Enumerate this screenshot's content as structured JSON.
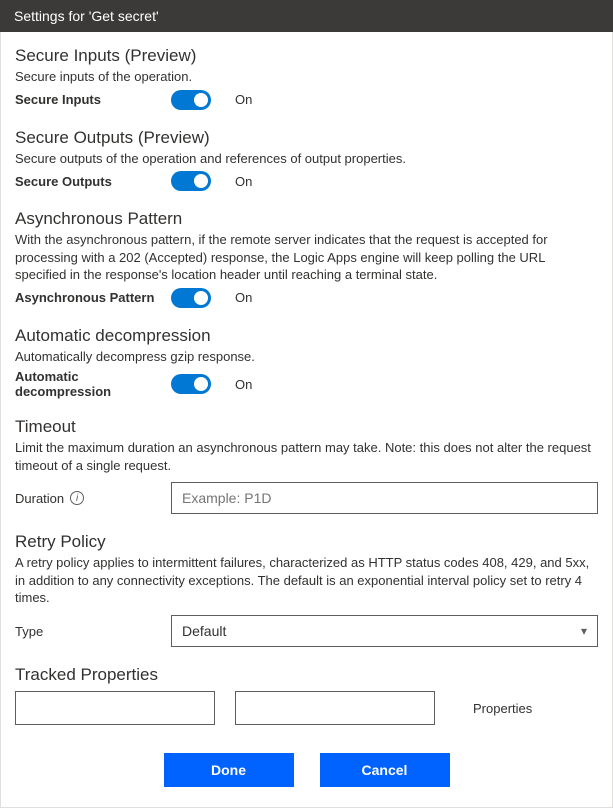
{
  "titlebar": "Settings for 'Get secret'",
  "secureInputs": {
    "heading": "Secure Inputs (Preview)",
    "desc": "Secure inputs of the operation.",
    "label": "Secure Inputs",
    "state": "On"
  },
  "secureOutputs": {
    "heading": "Secure Outputs (Preview)",
    "desc": "Secure outputs of the operation and references of output properties.",
    "label": "Secure Outputs",
    "state": "On"
  },
  "asyncPattern": {
    "heading": "Asynchronous Pattern",
    "desc": "With the asynchronous pattern, if the remote server indicates that the request is accepted for processing with a 202 (Accepted) response, the Logic Apps engine will keep polling the URL specified in the response's location header until reaching a terminal state.",
    "label": "Asynchronous Pattern",
    "state": "On"
  },
  "autoDecomp": {
    "heading": "Automatic decompression",
    "desc": "Automatically decompress gzip response.",
    "label": "Automatic decompression",
    "state": "On"
  },
  "timeout": {
    "heading": "Timeout",
    "desc": "Limit the maximum duration an asynchronous pattern may take. Note: this does not alter the request timeout of a single request.",
    "label": "Duration",
    "placeholder": "Example: P1D",
    "value": ""
  },
  "retry": {
    "heading": "Retry Policy",
    "desc": "A retry policy applies to intermittent failures, characterized as HTTP status codes 408, 429, and 5xx, in addition to any connectivity exceptions. The default is an exponential interval policy set to retry 4 times.",
    "label": "Type",
    "selected": "Default"
  },
  "tracked": {
    "heading": "Tracked Properties",
    "key": "",
    "value": "",
    "label": "Properties"
  },
  "buttons": {
    "done": "Done",
    "cancel": "Cancel"
  }
}
